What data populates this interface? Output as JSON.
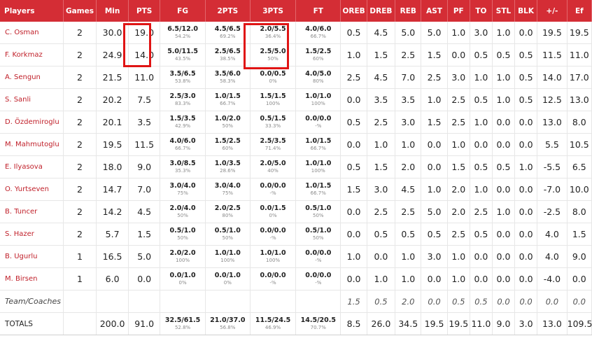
{
  "columns": [
    "Players",
    "Games",
    "Min",
    "PTS",
    "FG",
    "2PTS",
    "3PTS",
    "FT",
    "OREB",
    "DREB",
    "REB",
    "AST",
    "PF",
    "TO",
    "STL",
    "BLK",
    "+/-",
    "Ef"
  ],
  "players": [
    {
      "name": "C. Osman",
      "games": "2",
      "min": "30.0",
      "pts": "19.0",
      "fg": {
        "m": "6.5/12.0",
        "p": "54.2%"
      },
      "two": {
        "m": "4.5/6.5",
        "p": "69.2%"
      },
      "three": {
        "m": "2.0/5.5",
        "p": "36.4%"
      },
      "ft": {
        "m": "4.0/6.0",
        "p": "66.7%"
      },
      "oreb": "0.5",
      "dreb": "4.5",
      "reb": "5.0",
      "ast": "5.0",
      "pf": "1.0",
      "to": "3.0",
      "stl": "1.0",
      "blk": "0.0",
      "pm": "19.5",
      "ef": "19.5"
    },
    {
      "name": "F. Korkmaz",
      "games": "2",
      "min": "24.9",
      "pts": "14.0",
      "fg": {
        "m": "5.0/11.5",
        "p": "43.5%"
      },
      "two": {
        "m": "2.5/6.5",
        "p": "38.5%"
      },
      "three": {
        "m": "2.5/5.0",
        "p": "50%"
      },
      "ft": {
        "m": "1.5/2.5",
        "p": "60%"
      },
      "oreb": "1.0",
      "dreb": "1.5",
      "reb": "2.5",
      "ast": "1.5",
      "pf": "0.0",
      "to": "0.5",
      "stl": "0.5",
      "blk": "0.5",
      "pm": "11.5",
      "ef": "11.0"
    },
    {
      "name": "A. Sengun",
      "games": "2",
      "min": "21.5",
      "pts": "11.0",
      "fg": {
        "m": "3.5/6.5",
        "p": "53.8%"
      },
      "two": {
        "m": "3.5/6.0",
        "p": "58.3%"
      },
      "three": {
        "m": "0.0/0.5",
        "p": "0%"
      },
      "ft": {
        "m": "4.0/5.0",
        "p": "80%"
      },
      "oreb": "2.5",
      "dreb": "4.5",
      "reb": "7.0",
      "ast": "2.5",
      "pf": "3.0",
      "to": "1.0",
      "stl": "1.0",
      "blk": "0.5",
      "pm": "14.0",
      "ef": "17.0"
    },
    {
      "name": "S. Sanli",
      "games": "2",
      "min": "20.2",
      "pts": "7.5",
      "fg": {
        "m": "2.5/3.0",
        "p": "83.3%"
      },
      "two": {
        "m": "1.0/1.5",
        "p": "66.7%"
      },
      "three": {
        "m": "1.5/1.5",
        "p": "100%"
      },
      "ft": {
        "m": "1.0/1.0",
        "p": "100%"
      },
      "oreb": "0.0",
      "dreb": "3.5",
      "reb": "3.5",
      "ast": "1.0",
      "pf": "2.5",
      "to": "0.5",
      "stl": "1.0",
      "blk": "0.5",
      "pm": "12.5",
      "ef": "13.0"
    },
    {
      "name": "D. Özdemiroglu",
      "games": "2",
      "min": "20.1",
      "pts": "3.5",
      "fg": {
        "m": "1.5/3.5",
        "p": "42.9%"
      },
      "two": {
        "m": "1.0/2.0",
        "p": "50%"
      },
      "three": {
        "m": "0.5/1.5",
        "p": "33.3%"
      },
      "ft": {
        "m": "0.0/0.0",
        "p": "-%"
      },
      "oreb": "0.5",
      "dreb": "2.5",
      "reb": "3.0",
      "ast": "1.5",
      "pf": "2.5",
      "to": "1.0",
      "stl": "0.0",
      "blk": "0.0",
      "pm": "13.0",
      "ef": "8.0"
    },
    {
      "name": "M. Mahmutoglu",
      "games": "2",
      "min": "19.5",
      "pts": "11.5",
      "fg": {
        "m": "4.0/6.0",
        "p": "66.7%"
      },
      "two": {
        "m": "1.5/2.5",
        "p": "60%"
      },
      "three": {
        "m": "2.5/3.5",
        "p": "71.4%"
      },
      "ft": {
        "m": "1.0/1.5",
        "p": "66.7%"
      },
      "oreb": "0.0",
      "dreb": "1.0",
      "reb": "1.0",
      "ast": "0.0",
      "pf": "1.0",
      "to": "0.0",
      "stl": "0.0",
      "blk": "0.0",
      "pm": "5.5",
      "ef": "10.5"
    },
    {
      "name": "E. Ilyasova",
      "games": "2",
      "min": "18.0",
      "pts": "9.0",
      "fg": {
        "m": "3.0/8.5",
        "p": "35.3%"
      },
      "two": {
        "m": "1.0/3.5",
        "p": "28.6%"
      },
      "three": {
        "m": "2.0/5.0",
        "p": "40%"
      },
      "ft": {
        "m": "1.0/1.0",
        "p": "100%"
      },
      "oreb": "0.5",
      "dreb": "1.5",
      "reb": "2.0",
      "ast": "0.0",
      "pf": "1.5",
      "to": "0.5",
      "stl": "0.5",
      "blk": "1.0",
      "pm": "-5.5",
      "ef": "6.5"
    },
    {
      "name": "O. Yurtseven",
      "games": "2",
      "min": "14.7",
      "pts": "7.0",
      "fg": {
        "m": "3.0/4.0",
        "p": "75%"
      },
      "two": {
        "m": "3.0/4.0",
        "p": "75%"
      },
      "three": {
        "m": "0.0/0.0",
        "p": "-%"
      },
      "ft": {
        "m": "1.0/1.5",
        "p": "66.7%"
      },
      "oreb": "1.5",
      "dreb": "3.0",
      "reb": "4.5",
      "ast": "1.0",
      "pf": "2.0",
      "to": "1.0",
      "stl": "0.0",
      "blk": "0.0",
      "pm": "-7.0",
      "ef": "10.0"
    },
    {
      "name": "B. Tuncer",
      "games": "2",
      "min": "14.2",
      "pts": "4.5",
      "fg": {
        "m": "2.0/4.0",
        "p": "50%"
      },
      "two": {
        "m": "2.0/2.5",
        "p": "80%"
      },
      "three": {
        "m": "0.0/1.5",
        "p": "0%"
      },
      "ft": {
        "m": "0.5/1.0",
        "p": "50%"
      },
      "oreb": "0.0",
      "dreb": "2.5",
      "reb": "2.5",
      "ast": "5.0",
      "pf": "2.0",
      "to": "2.5",
      "stl": "1.0",
      "blk": "0.0",
      "pm": "-2.5",
      "ef": "8.0"
    },
    {
      "name": "S. Hazer",
      "games": "2",
      "min": "5.7",
      "pts": "1.5",
      "fg": {
        "m": "0.5/1.0",
        "p": "50%"
      },
      "two": {
        "m": "0.5/1.0",
        "p": "50%"
      },
      "three": {
        "m": "0.0/0.0",
        "p": "-%"
      },
      "ft": {
        "m": "0.5/1.0",
        "p": "50%"
      },
      "oreb": "0.0",
      "dreb": "0.5",
      "reb": "0.5",
      "ast": "0.5",
      "pf": "2.5",
      "to": "0.5",
      "stl": "0.0",
      "blk": "0.0",
      "pm": "4.0",
      "ef": "1.5"
    },
    {
      "name": "B. Ugurlu",
      "games": "1",
      "min": "16.5",
      "pts": "5.0",
      "fg": {
        "m": "2.0/2.0",
        "p": "100%"
      },
      "two": {
        "m": "1.0/1.0",
        "p": "100%"
      },
      "three": {
        "m": "1.0/1.0",
        "p": "100%"
      },
      "ft": {
        "m": "0.0/0.0",
        "p": "-%"
      },
      "oreb": "1.0",
      "dreb": "0.0",
      "reb": "1.0",
      "ast": "3.0",
      "pf": "1.0",
      "to": "0.0",
      "stl": "0.0",
      "blk": "0.0",
      "pm": "4.0",
      "ef": "9.0"
    },
    {
      "name": "M. Birsen",
      "games": "1",
      "min": "6.0",
      "pts": "0.0",
      "fg": {
        "m": "0.0/1.0",
        "p": "0%"
      },
      "two": {
        "m": "0.0/1.0",
        "p": "0%"
      },
      "three": {
        "m": "0.0/0.0",
        "p": "-%"
      },
      "ft": {
        "m": "0.0/0.0",
        "p": "-%"
      },
      "oreb": "0.0",
      "dreb": "1.0",
      "reb": "1.0",
      "ast": "0.0",
      "pf": "1.0",
      "to": "0.0",
      "stl": "0.0",
      "blk": "0.0",
      "pm": "-4.0",
      "ef": "0.0"
    }
  ],
  "team": {
    "label": "Team/Coaches",
    "oreb": "1.5",
    "dreb": "0.5",
    "reb": "2.0",
    "ast": "0.0",
    "pf": "0.5",
    "to": "0.5",
    "stl": "0.0",
    "blk": "0.0",
    "pm": "0.0",
    "ef": "0.0"
  },
  "totals": {
    "label": "TOTALS",
    "min": "200.0",
    "pts": "91.0",
    "fg": {
      "m": "32.5/61.5",
      "p": "52.8%"
    },
    "two": {
      "m": "21.0/37.0",
      "p": "56.8%"
    },
    "three": {
      "m": "11.5/24.5",
      "p": "46.9%"
    },
    "ft": {
      "m": "14.5/20.5",
      "p": "70.7%"
    },
    "oreb": "8.5",
    "dreb": "26.0",
    "reb": "34.5",
    "ast": "19.5",
    "pf": "19.5",
    "to": "11.0",
    "stl": "9.0",
    "blk": "3.0",
    "pm": "13.0",
    "ef": "109.5"
  },
  "colors": {
    "header_bg": "#d42d35",
    "player_link": "#c0202a",
    "highlight": "#e01414"
  }
}
